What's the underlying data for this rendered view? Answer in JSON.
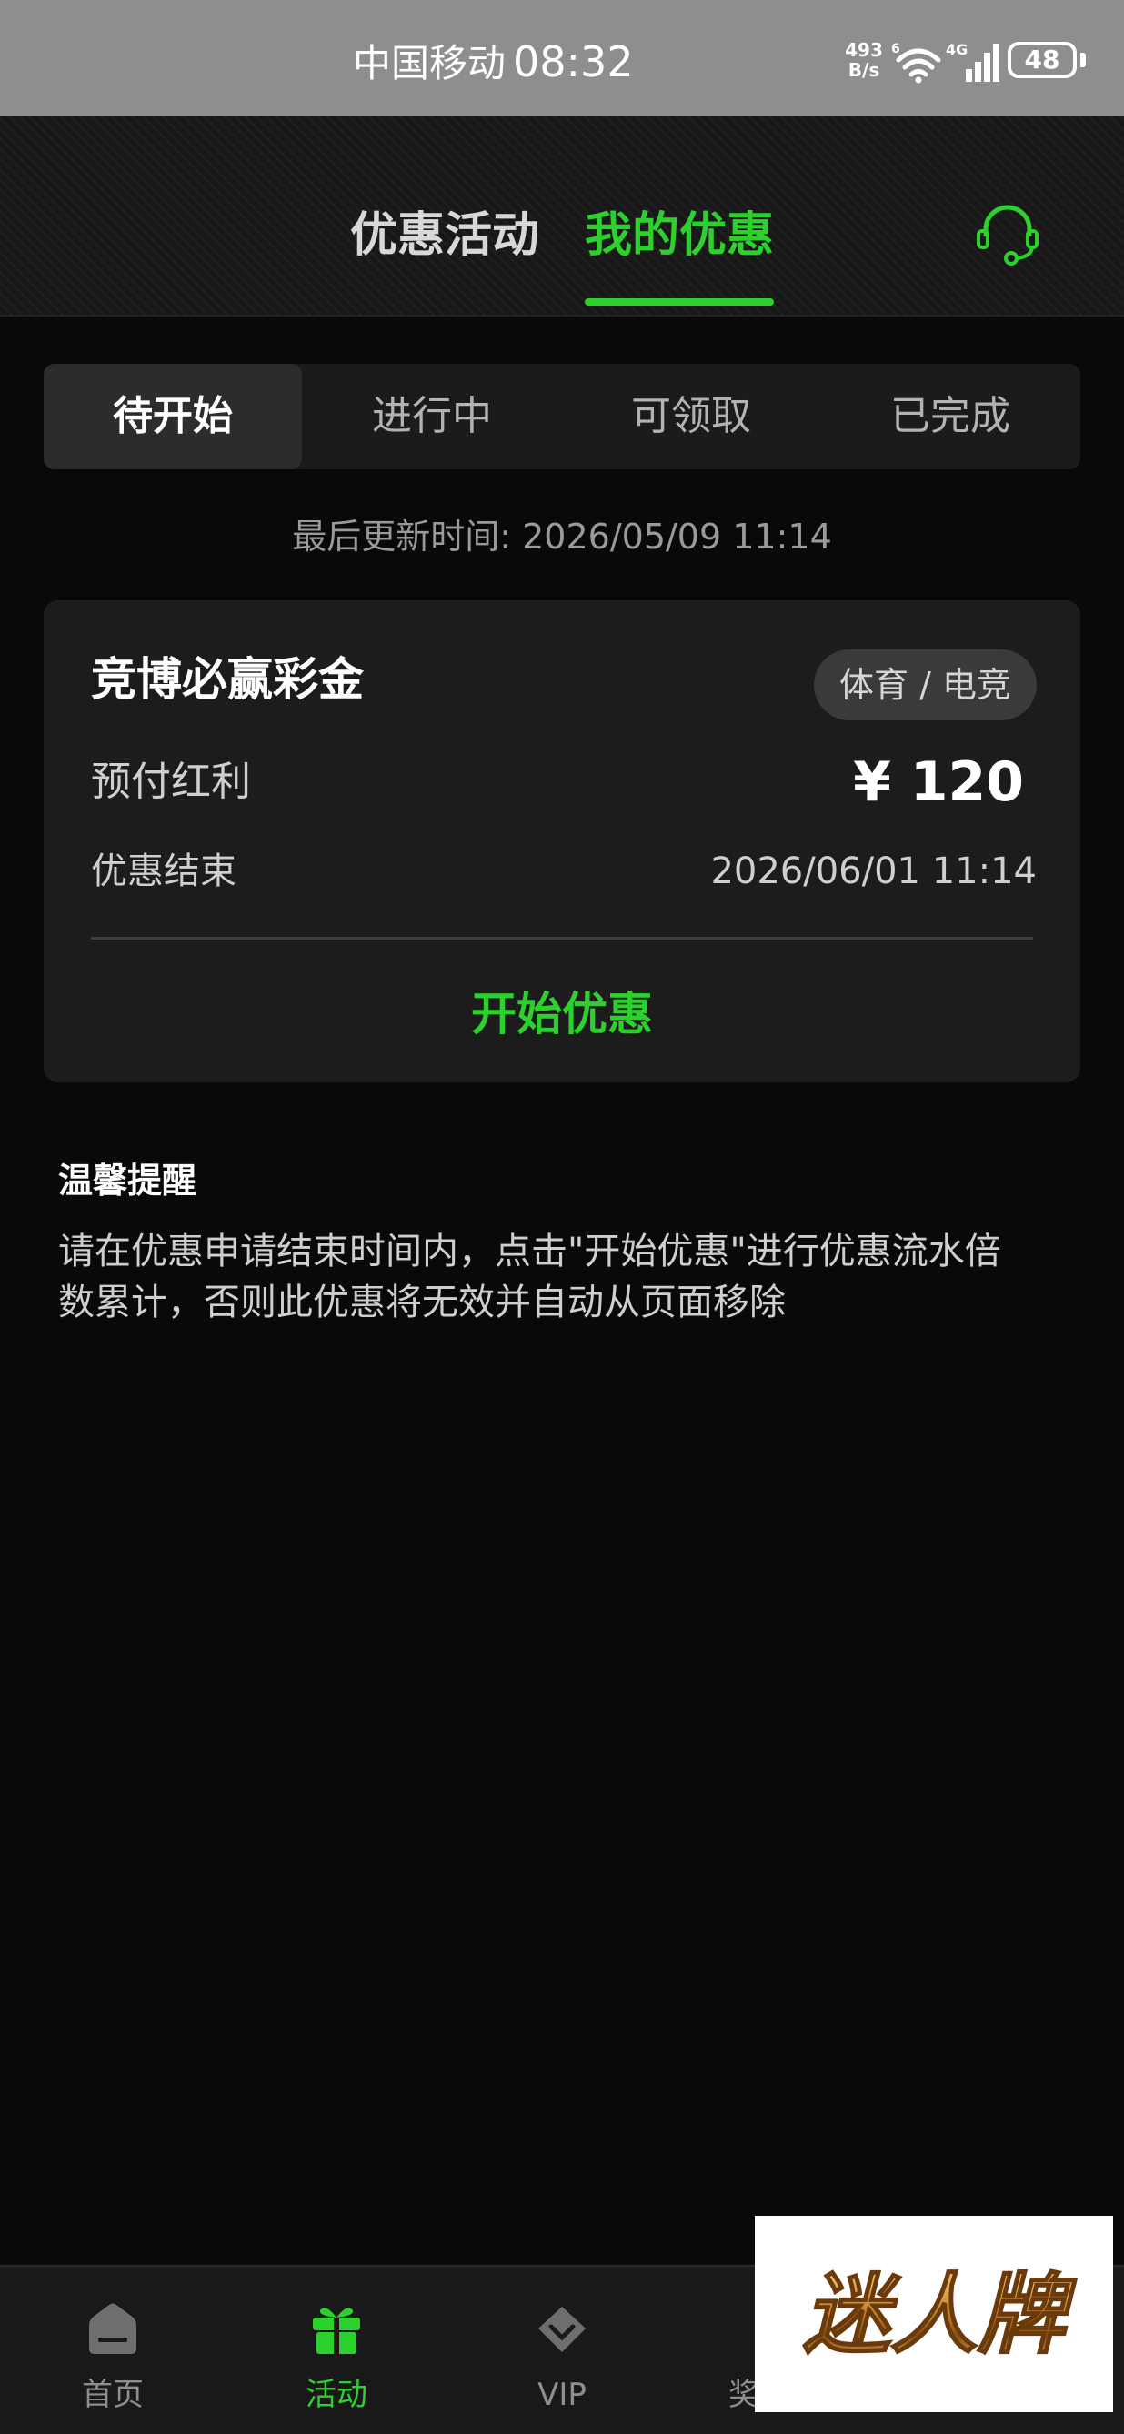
{
  "status_bar": {
    "carrier": "中国移动",
    "time": "08:32",
    "net_speed_value": "493",
    "net_speed_unit": "B/s",
    "network_type": "4G",
    "battery": "48"
  },
  "header": {
    "tabs": [
      {
        "label": "优惠活动",
        "active": false
      },
      {
        "label": "我的优惠",
        "active": true
      }
    ],
    "support_icon": "headset-icon",
    "accent_color": "#2dd12d"
  },
  "status_tabs": [
    {
      "label": "待开始",
      "active": true
    },
    {
      "label": "进行中",
      "active": false
    },
    {
      "label": "可领取",
      "active": false
    },
    {
      "label": "已完成",
      "active": false
    }
  ],
  "last_update": "最后更新时间: 2026/05/09 11:14",
  "promo_card": {
    "title": "竞博必赢彩金",
    "tag": "体育 / 电竞",
    "amount_label": "预付红利",
    "amount": "¥ 120",
    "end_label": "优惠结束",
    "end_date": "2026/06/01 11:14",
    "action": "开始优惠"
  },
  "reminder": {
    "title": "温馨提醒",
    "body": "请在优惠申请结束时间内，点击\"开始优惠\"进行优惠流水倍数累计，否则此优惠将无效并自动从页面移除"
  },
  "bottom_nav": {
    "items": [
      {
        "label": "首页",
        "icon": "home-icon",
        "active": false
      },
      {
        "label": "活动",
        "icon": "gift-icon",
        "active": true
      },
      {
        "label": "VIP",
        "icon": "diamond-icon",
        "active": false
      },
      {
        "label": "奖",
        "icon": "reward-icon",
        "active": false
      }
    ]
  },
  "watermark": {
    "text": "迷人牌"
  }
}
